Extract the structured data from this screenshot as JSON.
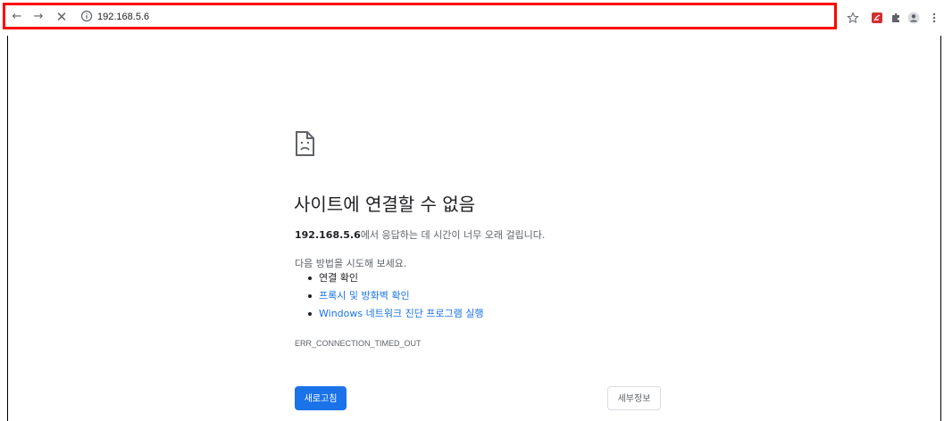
{
  "browser": {
    "url": "192.168.5.6",
    "icons": [
      "back-icon",
      "forward-icon",
      "stop-icon",
      "info-icon",
      "star-icon",
      "pdf-extension-icon",
      "extensions-puzzle-icon",
      "profile-icon",
      "menu-kebab-icon"
    ]
  },
  "error_page": {
    "title": "사이트에 연결할 수 없음",
    "desc_host": "192.168.5.6",
    "desc_rest": "에서 응답하는 데 시간이 너무 오래 걸립니다.",
    "try_text": "다음 방법을 시도해 보세요.",
    "suggestions": [
      {
        "label": "연결 확인"
      },
      {
        "label": "프록시 및 방화벽 확인"
      },
      {
        "label": "Windows 네트워크 진단 프로그램 실행"
      }
    ],
    "error_code": "ERR_CONNECTION_TIMED_OUT",
    "reload_label": "새로고침",
    "details_label": "세부정보"
  },
  "colors": {
    "accent": "#1a73e8",
    "highlight_border": "#ff0000"
  }
}
